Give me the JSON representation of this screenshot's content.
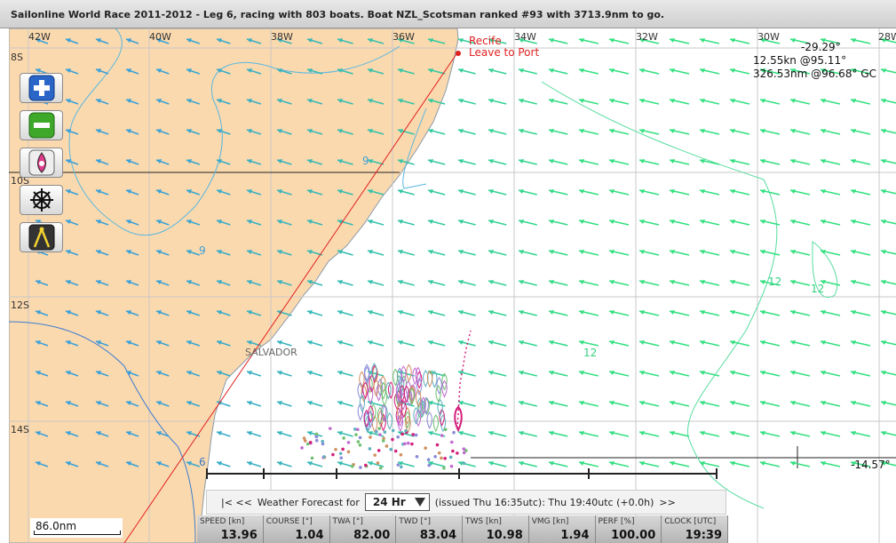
{
  "window": {
    "title": "Sailonline World Race 2011-2012 - Leg 6, racing with 803 boats. Boat NZL_Scotsman ranked #93 with 3713.9nm to go."
  },
  "map": {
    "lon_labels": [
      "42W",
      "40W",
      "38W",
      "36W",
      "34W",
      "32W",
      "30W",
      "28W"
    ],
    "lat_labels": [
      "8S",
      "10S",
      "12S",
      "14S"
    ],
    "places": {
      "recife": "Recife",
      "leave_to_port": "Leave to Port",
      "salvador": "SALVADOR"
    },
    "isobar_labels": [
      "9",
      "9",
      "12",
      "12",
      "12",
      "6"
    ],
    "colors": {
      "land": "#fbd9ae",
      "grid": "#c8c8c8",
      "wind_light": "#3aa0d8",
      "wind_strong": "#33e080",
      "route": "#e82020",
      "boat": "#d4207c"
    }
  },
  "info": {
    "cursor_lon": "-29.29°",
    "boat_speed": "12.55kn @95.11°",
    "gc_distance": "326.53nm @96.68° GC",
    "cursor_lat": "-14.57°"
  },
  "tools": [
    {
      "name": "zoom-in",
      "icon": "plus-icon"
    },
    {
      "name": "zoom-out",
      "icon": "minus-icon"
    },
    {
      "name": "center-boat",
      "icon": "boat-center-icon"
    },
    {
      "name": "steering",
      "icon": "helm-wheel-icon"
    },
    {
      "name": "measure",
      "icon": "dividers-icon"
    }
  ],
  "forecast": {
    "nav_back": "|<  <<",
    "label": "Weather Forecast for",
    "selected": "24 Hr",
    "issued": "(issued Thu 16:35utc): Thu 19:40utc  (+0.0h)",
    "nav_forward": ">>"
  },
  "instruments": [
    {
      "label": "SPEED [kn]",
      "value": "13.96"
    },
    {
      "label": "COURSE [°]",
      "value": "1.04"
    },
    {
      "label": "TWA [°]",
      "value": "82.00"
    },
    {
      "label": "TWD [°]",
      "value": "83.04"
    },
    {
      "label": "TWS [kn]",
      "value": "10.98"
    },
    {
      "label": "VMG [kn]",
      "value": "1.94"
    },
    {
      "label": "PERF [%]",
      "value": "100.00"
    },
    {
      "label": "CLOCK [UTC]",
      "value": "19:39"
    }
  ],
  "scale": {
    "label": "86.0nm"
  }
}
